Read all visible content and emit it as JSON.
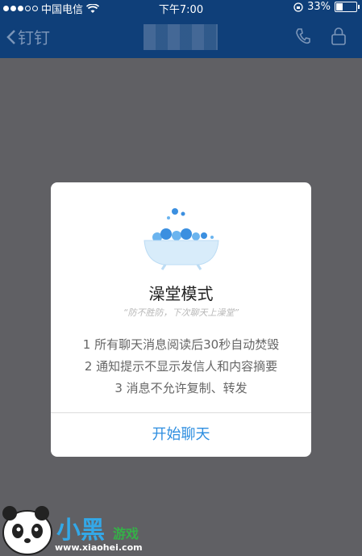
{
  "status_bar": {
    "carrier": "中国电信",
    "time": "下午7:00",
    "battery": "33%",
    "battery_level": 0.33
  },
  "nav": {
    "back_label": "钉钉",
    "icons": [
      "phone-icon",
      "lock-icon"
    ]
  },
  "dialog": {
    "title": "澡堂模式",
    "subtitle": "“防不胜防，下次聊天上澡堂”",
    "rules": [
      "1 所有聊天消息阅读后30秒自动焚毁",
      "2 通知提示不显示发信人和内容摘要",
      "3 消息不允许复制、转发"
    ],
    "action": "开始聊天"
  },
  "watermark": {
    "brand": "小黑",
    "brand_game": "游戏",
    "url": "www.xiaohei.com"
  },
  "colors": {
    "nav_bg": "#0f3f79",
    "overlay": "#606064",
    "action": "#2d8ee0"
  }
}
